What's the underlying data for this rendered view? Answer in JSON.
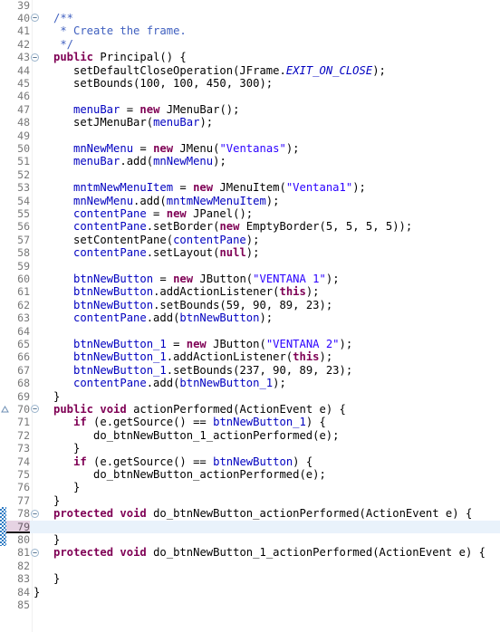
{
  "editor": {
    "language": "java",
    "first_line": 39,
    "last_line": 85,
    "current_line": 79,
    "colors": {
      "keyword": "#7F0055",
      "string": "#2A00FF",
      "comment": "#3F5FBF",
      "field": "#0000C0",
      "plain": "#000000",
      "line_number": "#787878",
      "current_line_bg": "#E9F2FB",
      "current_line_number_bg": "#E6D3E3",
      "change_bar": "#2F7CC4",
      "background": "#FFFFFF"
    },
    "change_bar_lines": [
      78,
      79,
      80
    ],
    "fold_marker_lines": [
      40,
      43,
      70,
      78,
      81
    ],
    "override_marker_lines": [
      70
    ],
    "lines": [
      {
        "n": 39,
        "indent": 0,
        "tokens": []
      },
      {
        "n": 40,
        "indent": 1,
        "tokens": [
          {
            "t": "cmt",
            "s": "/**"
          }
        ]
      },
      {
        "n": 41,
        "indent": 1,
        "tokens": [
          {
            "t": "cmt",
            "s": " * Create the frame."
          }
        ]
      },
      {
        "n": 42,
        "indent": 1,
        "tokens": [
          {
            "t": "cmt",
            "s": " */"
          }
        ]
      },
      {
        "n": 43,
        "indent": 1,
        "tokens": [
          {
            "t": "kw",
            "s": "public"
          },
          {
            "t": "pl",
            "s": " Principal() {"
          }
        ]
      },
      {
        "n": 44,
        "indent": 2,
        "tokens": [
          {
            "t": "pl",
            "s": "setDefaultCloseOperation(JFrame."
          },
          {
            "t": "sfld",
            "s": "EXIT_ON_CLOSE"
          },
          {
            "t": "pl",
            "s": ");"
          }
        ]
      },
      {
        "n": 45,
        "indent": 2,
        "tokens": [
          {
            "t": "pl",
            "s": "setBounds(100, 100, 450, 300);"
          }
        ]
      },
      {
        "n": 46,
        "indent": 0,
        "tokens": []
      },
      {
        "n": 47,
        "indent": 2,
        "tokens": [
          {
            "t": "fld",
            "s": "menuBar"
          },
          {
            "t": "pl",
            "s": " = "
          },
          {
            "t": "kw",
            "s": "new"
          },
          {
            "t": "pl",
            "s": " JMenuBar();"
          }
        ]
      },
      {
        "n": 48,
        "indent": 2,
        "tokens": [
          {
            "t": "pl",
            "s": "setJMenuBar("
          },
          {
            "t": "fld",
            "s": "menuBar"
          },
          {
            "t": "pl",
            "s": ");"
          }
        ]
      },
      {
        "n": 49,
        "indent": 0,
        "tokens": []
      },
      {
        "n": 50,
        "indent": 2,
        "tokens": [
          {
            "t": "fld",
            "s": "mnNewMenu"
          },
          {
            "t": "pl",
            "s": " = "
          },
          {
            "t": "kw",
            "s": "new"
          },
          {
            "t": "pl",
            "s": " JMenu("
          },
          {
            "t": "str",
            "s": "\"Ventanas\""
          },
          {
            "t": "pl",
            "s": ");"
          }
        ]
      },
      {
        "n": 51,
        "indent": 2,
        "tokens": [
          {
            "t": "fld",
            "s": "menuBar"
          },
          {
            "t": "pl",
            "s": ".add("
          },
          {
            "t": "fld",
            "s": "mnNewMenu"
          },
          {
            "t": "pl",
            "s": ");"
          }
        ]
      },
      {
        "n": 52,
        "indent": 0,
        "tokens": []
      },
      {
        "n": 53,
        "indent": 2,
        "tokens": [
          {
            "t": "fld",
            "s": "mntmNewMenuItem"
          },
          {
            "t": "pl",
            "s": " = "
          },
          {
            "t": "kw",
            "s": "new"
          },
          {
            "t": "pl",
            "s": " JMenuItem("
          },
          {
            "t": "str",
            "s": "\"Ventana1\""
          },
          {
            "t": "pl",
            "s": ");"
          }
        ]
      },
      {
        "n": 54,
        "indent": 2,
        "tokens": [
          {
            "t": "fld",
            "s": "mnNewMenu"
          },
          {
            "t": "pl",
            "s": ".add("
          },
          {
            "t": "fld",
            "s": "mntmNewMenuItem"
          },
          {
            "t": "pl",
            "s": ");"
          }
        ]
      },
      {
        "n": 55,
        "indent": 2,
        "tokens": [
          {
            "t": "fld",
            "s": "contentPane"
          },
          {
            "t": "pl",
            "s": " = "
          },
          {
            "t": "kw",
            "s": "new"
          },
          {
            "t": "pl",
            "s": " JPanel();"
          }
        ]
      },
      {
        "n": 56,
        "indent": 2,
        "tokens": [
          {
            "t": "fld",
            "s": "contentPane"
          },
          {
            "t": "pl",
            "s": ".setBorder("
          },
          {
            "t": "kw",
            "s": "new"
          },
          {
            "t": "pl",
            "s": " EmptyBorder(5, 5, 5, 5));"
          }
        ]
      },
      {
        "n": 57,
        "indent": 2,
        "tokens": [
          {
            "t": "pl",
            "s": "setContentPane("
          },
          {
            "t": "fld",
            "s": "contentPane"
          },
          {
            "t": "pl",
            "s": ");"
          }
        ]
      },
      {
        "n": 58,
        "indent": 2,
        "tokens": [
          {
            "t": "fld",
            "s": "contentPane"
          },
          {
            "t": "pl",
            "s": ".setLayout("
          },
          {
            "t": "kw",
            "s": "null"
          },
          {
            "t": "pl",
            "s": ");"
          }
        ]
      },
      {
        "n": 59,
        "indent": 0,
        "tokens": []
      },
      {
        "n": 60,
        "indent": 2,
        "tokens": [
          {
            "t": "fld",
            "s": "btnNewButton"
          },
          {
            "t": "pl",
            "s": " = "
          },
          {
            "t": "kw",
            "s": "new"
          },
          {
            "t": "pl",
            "s": " JButton("
          },
          {
            "t": "str",
            "s": "\"VENTANA 1\""
          },
          {
            "t": "pl",
            "s": ");"
          }
        ]
      },
      {
        "n": 61,
        "indent": 2,
        "tokens": [
          {
            "t": "fld",
            "s": "btnNewButton"
          },
          {
            "t": "pl",
            "s": ".addActionListener("
          },
          {
            "t": "kw",
            "s": "this"
          },
          {
            "t": "pl",
            "s": ");"
          }
        ]
      },
      {
        "n": 62,
        "indent": 2,
        "tokens": [
          {
            "t": "fld",
            "s": "btnNewButton"
          },
          {
            "t": "pl",
            "s": ".setBounds(59, 90, 89, 23);"
          }
        ]
      },
      {
        "n": 63,
        "indent": 2,
        "tokens": [
          {
            "t": "fld",
            "s": "contentPane"
          },
          {
            "t": "pl",
            "s": ".add("
          },
          {
            "t": "fld",
            "s": "btnNewButton"
          },
          {
            "t": "pl",
            "s": ");"
          }
        ]
      },
      {
        "n": 64,
        "indent": 0,
        "tokens": []
      },
      {
        "n": 65,
        "indent": 2,
        "tokens": [
          {
            "t": "fld",
            "s": "btnNewButton_1"
          },
          {
            "t": "pl",
            "s": " = "
          },
          {
            "t": "kw",
            "s": "new"
          },
          {
            "t": "pl",
            "s": " JButton("
          },
          {
            "t": "str",
            "s": "\"VENTANA 2\""
          },
          {
            "t": "pl",
            "s": ");"
          }
        ]
      },
      {
        "n": 66,
        "indent": 2,
        "tokens": [
          {
            "t": "fld",
            "s": "btnNewButton_1"
          },
          {
            "t": "pl",
            "s": ".addActionListener("
          },
          {
            "t": "kw",
            "s": "this"
          },
          {
            "t": "pl",
            "s": ");"
          }
        ]
      },
      {
        "n": 67,
        "indent": 2,
        "tokens": [
          {
            "t": "fld",
            "s": "btnNewButton_1"
          },
          {
            "t": "pl",
            "s": ".setBounds(237, 90, 89, 23);"
          }
        ]
      },
      {
        "n": 68,
        "indent": 2,
        "tokens": [
          {
            "t": "fld",
            "s": "contentPane"
          },
          {
            "t": "pl",
            "s": ".add("
          },
          {
            "t": "fld",
            "s": "btnNewButton_1"
          },
          {
            "t": "pl",
            "s": ");"
          }
        ]
      },
      {
        "n": 69,
        "indent": 1,
        "tokens": [
          {
            "t": "pl",
            "s": "}"
          }
        ]
      },
      {
        "n": 70,
        "indent": 1,
        "tokens": [
          {
            "t": "kw",
            "s": "public"
          },
          {
            "t": "pl",
            "s": " "
          },
          {
            "t": "kw",
            "s": "void"
          },
          {
            "t": "pl",
            "s": " actionPerformed(ActionEvent e) {"
          }
        ]
      },
      {
        "n": 71,
        "indent": 2,
        "tokens": [
          {
            "t": "kw",
            "s": "if"
          },
          {
            "t": "pl",
            "s": " (e.getSource() == "
          },
          {
            "t": "fld",
            "s": "btnNewButton_1"
          },
          {
            "t": "pl",
            "s": ") {"
          }
        ]
      },
      {
        "n": 72,
        "indent": 3,
        "tokens": [
          {
            "t": "pl",
            "s": "do_btnNewButton_1_actionPerformed(e);"
          }
        ]
      },
      {
        "n": 73,
        "indent": 2,
        "tokens": [
          {
            "t": "pl",
            "s": "}"
          }
        ]
      },
      {
        "n": 74,
        "indent": 2,
        "tokens": [
          {
            "t": "kw",
            "s": "if"
          },
          {
            "t": "pl",
            "s": " (e.getSource() == "
          },
          {
            "t": "fld",
            "s": "btnNewButton"
          },
          {
            "t": "pl",
            "s": ") {"
          }
        ]
      },
      {
        "n": 75,
        "indent": 3,
        "tokens": [
          {
            "t": "pl",
            "s": "do_btnNewButton_actionPerformed(e);"
          }
        ]
      },
      {
        "n": 76,
        "indent": 2,
        "tokens": [
          {
            "t": "pl",
            "s": "}"
          }
        ]
      },
      {
        "n": 77,
        "indent": 1,
        "tokens": [
          {
            "t": "pl",
            "s": "}"
          }
        ]
      },
      {
        "n": 78,
        "indent": 1,
        "tokens": [
          {
            "t": "kw",
            "s": "protected"
          },
          {
            "t": "pl",
            "s": " "
          },
          {
            "t": "kw",
            "s": "void"
          },
          {
            "t": "pl",
            "s": " do_btnNewButton_actionPerformed(ActionEvent e) {"
          }
        ]
      },
      {
        "n": 79,
        "indent": 0,
        "tokens": []
      },
      {
        "n": 80,
        "indent": 1,
        "tokens": [
          {
            "t": "pl",
            "s": "}"
          }
        ]
      },
      {
        "n": 81,
        "indent": 1,
        "tokens": [
          {
            "t": "kw",
            "s": "protected"
          },
          {
            "t": "pl",
            "s": " "
          },
          {
            "t": "kw",
            "s": "void"
          },
          {
            "t": "pl",
            "s": " do_btnNewButton_1_actionPerformed(ActionEvent e) {"
          }
        ]
      },
      {
        "n": 82,
        "indent": 0,
        "tokens": []
      },
      {
        "n": 83,
        "indent": 1,
        "tokens": [
          {
            "t": "pl",
            "s": "}"
          }
        ]
      },
      {
        "n": 84,
        "indent": 0,
        "tokens": [
          {
            "t": "pl",
            "s": "}"
          }
        ]
      },
      {
        "n": 85,
        "indent": 0,
        "tokens": []
      }
    ]
  }
}
